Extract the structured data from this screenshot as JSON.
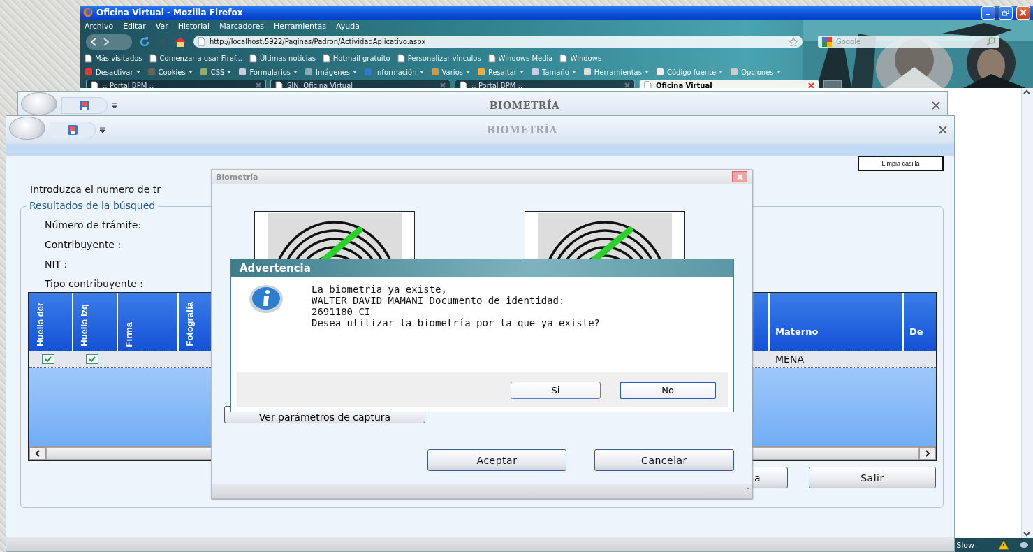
{
  "browser": {
    "title": "Oficina Virtual - Mozilla Firefox",
    "menu": [
      "Archivo",
      "Editar",
      "Ver",
      "Historial",
      "Marcadores",
      "Herramientas",
      "Ayuda"
    ],
    "url": "http://localhost:5922/Paginas/Padron/ActividadAplicativo.aspx",
    "search_placeholder": "Google",
    "bookmarks": [
      "Más visitados",
      "Comenzar a usar Firef...",
      "Últimas noticias",
      "Hotmail gratuito",
      "Personalizar vínculos",
      "Windows Media",
      "Windows"
    ],
    "toolbar": [
      "Desactivar",
      "Cookies",
      "CSS",
      "Formularios",
      "Imágenes",
      "Información",
      "Varios",
      "Resaltar",
      "Tamaño",
      "Herramientas",
      "Código fuente",
      "Opciones"
    ],
    "tabs": [
      {
        "label": ":: Portal BPM ::",
        "selected": false
      },
      {
        "label": "SIN: Oficina Virtual",
        "selected": false
      },
      {
        "label": ":: Portal BPM ::",
        "selected": false
      },
      {
        "label": "Oficina Virtual",
        "selected": true
      }
    ],
    "status": "Slow"
  },
  "back_window": {
    "title": "BIOMETRÍA"
  },
  "window": {
    "title": "BIOMETRÍA",
    "clear_button": "Limpia casilla",
    "prompt": "Introduzca el numero de tr",
    "group_title": "Resultados de la búsqued",
    "fields": [
      "Número de trámite:",
      "Contribuyente :",
      "NIT :",
      "Tipo contribuyente :"
    ],
    "table": {
      "columns": [
        {
          "label": "Huella der",
          "kind": "check"
        },
        {
          "label": "Huella izq",
          "kind": "check"
        },
        {
          "label": "Firma",
          "kind": "vertical"
        },
        {
          "label": "Fotografía",
          "kind": "vertical"
        },
        {
          "label": "Materno",
          "kind": "text"
        },
        {
          "label": "De",
          "kind": "text"
        }
      ],
      "rows": [
        {
          "huella_der": true,
          "huella_izq": true,
          "materno": "MENA"
        }
      ]
    },
    "buttons": [
      "a",
      "Salir"
    ]
  },
  "biometria": {
    "title": "Biometría",
    "capture_button": "Ver parámetros de captura",
    "actions": [
      "Aceptar",
      "Cancelar"
    ]
  },
  "alert": {
    "title": "Advertencia",
    "lines": [
      "La biometria ya existe,",
      "WALTER DAVID MAMANI Documento de identidad:",
      "2691180 CI",
      "Desea utilizar la biometría por la que ya existe?"
    ],
    "buttons": [
      {
        "label": "Si",
        "focused": false
      },
      {
        "label": "No",
        "focused": true
      }
    ]
  }
}
